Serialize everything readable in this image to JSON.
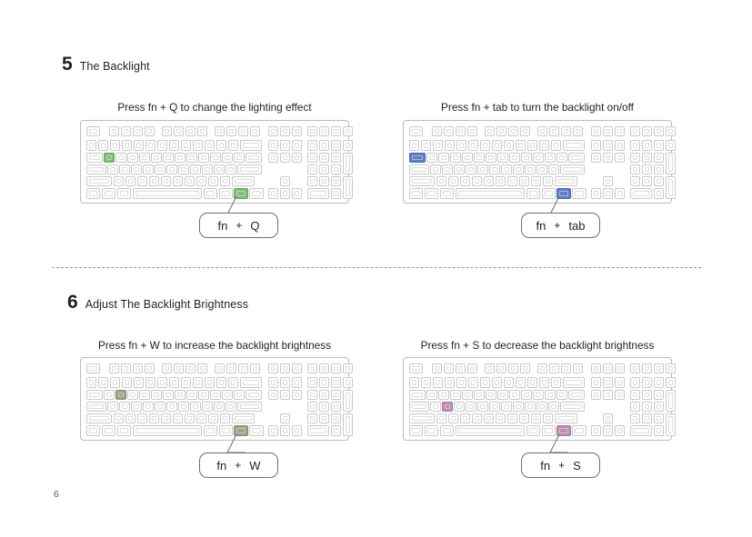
{
  "page": {
    "number": "6"
  },
  "sections": [
    {
      "number": "5",
      "title": "The Backlight",
      "panels": [
        {
          "caption": "Press fn + Q to change the lighting effect",
          "combo": {
            "modifier": "fn",
            "plus": "+",
            "key": "Q"
          },
          "highlight_color": "#83bd7c",
          "highlight_keys": [
            "Q",
            "fn"
          ]
        },
        {
          "caption": "Press fn + tab to turn the backlight on/off",
          "combo": {
            "modifier": "fn",
            "plus": "+",
            "key": "tab"
          },
          "highlight_color": "#5b7ec4",
          "highlight_keys": [
            "tab",
            "fn"
          ]
        }
      ]
    },
    {
      "number": "6",
      "title": "Adjust The Backlight Brightness",
      "panels": [
        {
          "caption": "Press fn + W to increase the backlight brightness",
          "combo": {
            "modifier": "fn",
            "plus": "+",
            "key": "W"
          },
          "highlight_color": "#9ba38c",
          "highlight_keys": [
            "W",
            "fn"
          ]
        },
        {
          "caption": "Press fn + S to decrease the backlight brightness",
          "combo": {
            "modifier": "fn",
            "plus": "+",
            "key": "S"
          },
          "highlight_color": "#bc8fb5",
          "highlight_keys": [
            "S",
            "fn"
          ]
        }
      ]
    }
  ],
  "divider": {
    "style": "dashed",
    "color": "#9a9a9a"
  }
}
